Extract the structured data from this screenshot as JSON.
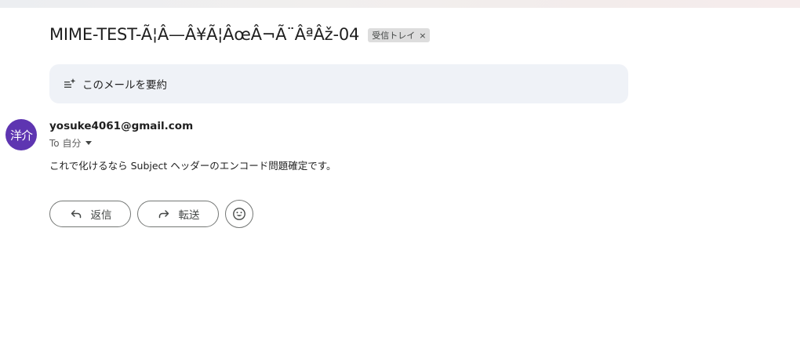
{
  "message": {
    "subject": "MIME-TEST-Ã¦Â—Â¥Ã¦ÂœÂ¬Ã¨ÂªÂž-04",
    "label": "受信トレイ",
    "label_close": "×",
    "summary_label": "このメールを要約",
    "avatar_initials": "洋介",
    "avatar_color": "#5e35b1",
    "sender_email": "yosuke4061@gmail.com",
    "to_text": "To 自分",
    "body": "これで化けるなら Subject ヘッダーのエンコード問題確定です。"
  },
  "actions": {
    "reply_label": "返信",
    "forward_label": "転送",
    "reply_icon": "reply-arrow-icon",
    "forward_icon": "forward-arrow-icon",
    "emoji_icon": "smiley-icon"
  }
}
